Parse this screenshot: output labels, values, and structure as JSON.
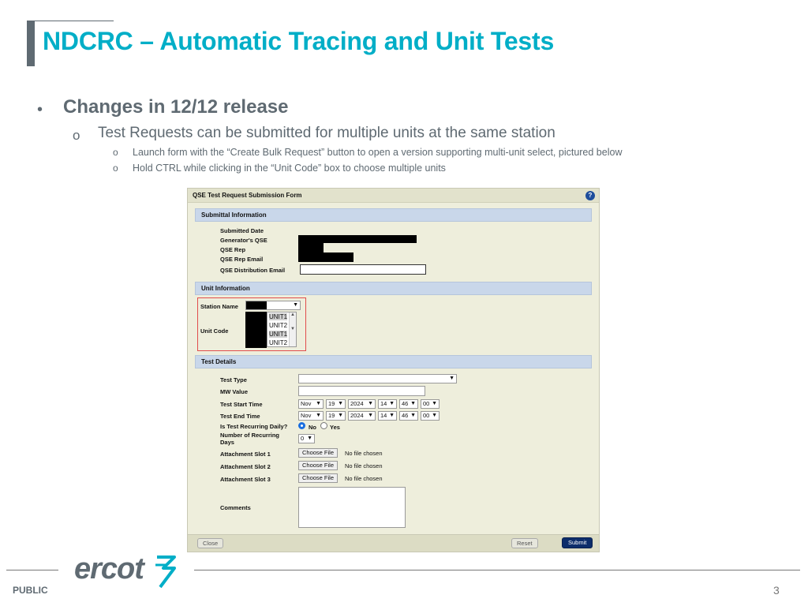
{
  "slide": {
    "title": "NDCRC – Automatic Tracing and Unit Tests",
    "bullet1": "Changes in 12/12 release",
    "bullet2": "Test Requests can be submitted for multiple units at the same station",
    "bullet3": [
      "Launch form with the “Create Bulk Request” button to open a version supporting multi-unit select, pictured below",
      "Hold CTRL while clicking in the “Unit Code” box to choose multiple units"
    ],
    "footer_label": "PUBLIC",
    "logo_text": "ercot",
    "page_number": "3"
  },
  "form": {
    "title": "QSE Test Request Submission Form",
    "help_icon": "?",
    "sections": {
      "submittal": "Submittal Information",
      "unit": "Unit Information",
      "test": "Test Details"
    },
    "submittal_fields": {
      "date": "Submitted Date",
      "qse": "Generator's QSE",
      "rep": "QSE Rep",
      "rep_email": "QSE Rep Email",
      "dist_email": "QSE Distribution Email"
    },
    "unit_fields": {
      "station": "Station Name",
      "unit_code": "Unit Code",
      "unit_options": [
        "UNIT1",
        "UNIT2",
        "UNIT1",
        "UNIT2"
      ]
    },
    "test_fields": {
      "type": "Test Type",
      "mw": "MW Value",
      "start": "Test Start Time",
      "end": "Test End Time",
      "recurring": "Is Test Recurring Daily?",
      "recurring_no": "No",
      "recurring_yes": "Yes",
      "num_days": "Number of Recurring Days",
      "num_days_value": "0",
      "slot1": "Attachment Slot 1",
      "slot2": "Attachment Slot 2",
      "slot3": "Attachment Slot 3",
      "comments": "Comments",
      "choose_file": "Choose File",
      "no_file": "No file chosen"
    },
    "datetime": {
      "month": "Nov",
      "day": "19",
      "year": "2024",
      "hour": "14",
      "minute": "46",
      "second": "00"
    },
    "buttons": {
      "close": "Close",
      "reset": "Reset",
      "submit": "Submit"
    }
  },
  "colors": {
    "title": "#00aec7",
    "text": "#5f6a72",
    "section_bg": "#c9d7ea",
    "form_bg": "#eeeedc",
    "submit_bg": "#0d2d6b",
    "highlight_border": "#e14c4c"
  }
}
